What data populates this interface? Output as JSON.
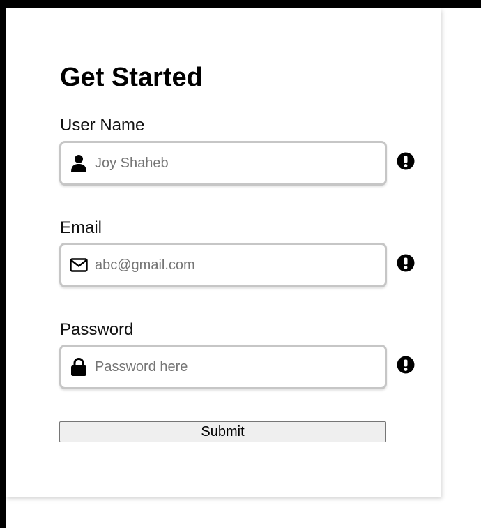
{
  "form": {
    "title": "Get Started",
    "fields": [
      {
        "label": "User Name",
        "placeholder": "Joy Shaheb",
        "icon": "user-icon",
        "status_icon": "alert-circle-icon"
      },
      {
        "label": "Email",
        "placeholder": "abc@gmail.com",
        "icon": "envelope-icon",
        "status_icon": "alert-circle-icon"
      },
      {
        "label": "Password",
        "placeholder": "Password here",
        "icon": "lock-icon",
        "status_icon": "alert-circle-icon"
      }
    ],
    "submit_label": "Submit"
  },
  "colors": {
    "frame": "#000000",
    "background": "#ffffff",
    "input_border": "#c6c6c6",
    "button_bg": "#efefef",
    "text": "#000000",
    "placeholder": "#757575"
  }
}
